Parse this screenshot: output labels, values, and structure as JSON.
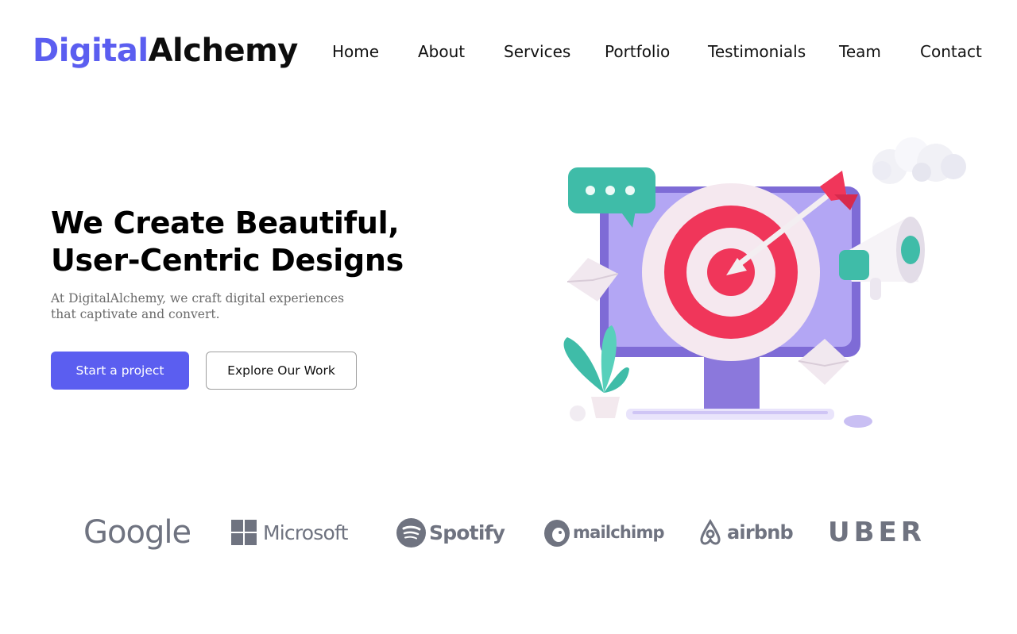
{
  "header": {
    "logo_part1": "Digital",
    "logo_part2": "Alchemy",
    "nav": [
      "Home",
      "About",
      "Services",
      "Portfolio",
      "Testimonials",
      "Team",
      "Contact"
    ]
  },
  "hero": {
    "title_line1": "We Create Beautiful,",
    "title_line2": "User-Centric Designs",
    "subtitle": "At DigitalAlchemy, we craft digital experiences that captivate and convert.",
    "primary_button": "Start a project",
    "secondary_button": "Explore Our Work"
  },
  "brands": [
    "Google",
    "Microsoft",
    "Spotify",
    "mailchimp",
    "airbnb",
    "UBER"
  ],
  "colors": {
    "accent": "#5b5ef0",
    "brand_gray": "#6f7380",
    "target_red": "#f0365a",
    "monitor_purple": "#a99cf0",
    "teal": "#3fbca8"
  }
}
